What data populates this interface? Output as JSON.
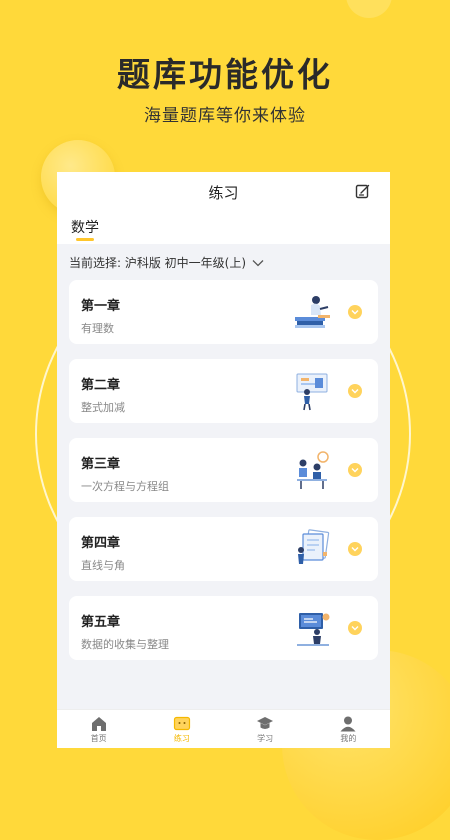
{
  "hero": {
    "title": "题库功能优化",
    "subtitle": "海量题库等你来体验"
  },
  "header": {
    "title": "练习",
    "edit_icon": "edit-icon"
  },
  "subject_tab": {
    "label": "数学"
  },
  "selector": {
    "text": "当前选择: 沪科版 初中一年级(上)",
    "icon": "chevron-down-icon"
  },
  "chapters": [
    {
      "title": "第一章",
      "subtitle": "有理数"
    },
    {
      "title": "第二章",
      "subtitle": "整式加减"
    },
    {
      "title": "第三章",
      "subtitle": "一次方程与方程组"
    },
    {
      "title": "第四章",
      "subtitle": "直线与角"
    },
    {
      "title": "第五章",
      "subtitle": "数据的收集与整理"
    }
  ],
  "tabbar": {
    "items": [
      {
        "label": "首页",
        "icon": "home-icon"
      },
      {
        "label": "练习",
        "icon": "practice-icon",
        "active": true
      },
      {
        "label": "学习",
        "icon": "graduation-cap-icon"
      },
      {
        "label": "我的",
        "icon": "profile-icon"
      }
    ]
  },
  "colors": {
    "background": "#FFD93A",
    "accent": "#FFC62B",
    "active_tab": "#F5B800"
  }
}
